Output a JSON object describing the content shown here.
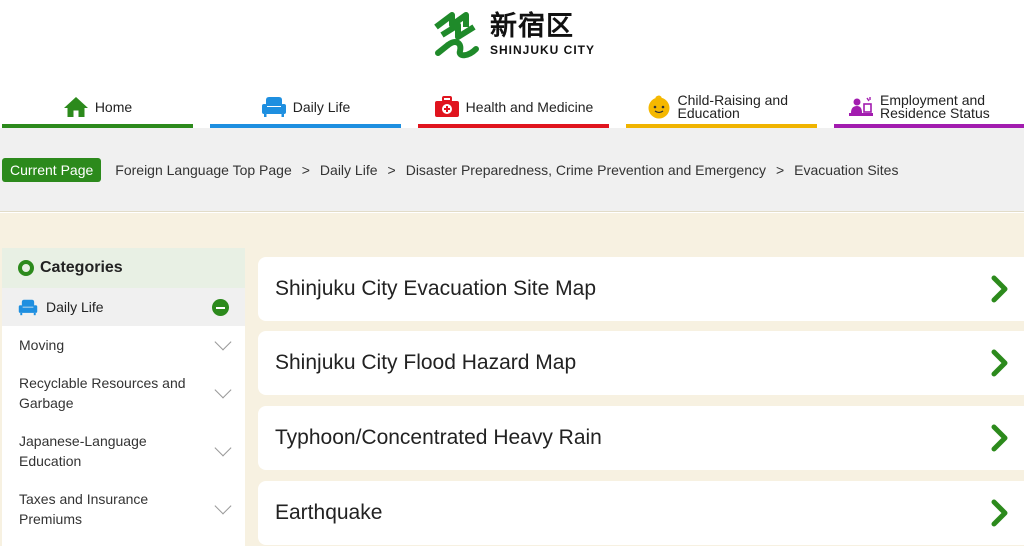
{
  "logo": {
    "kanji": "新宿区",
    "subtitle": "SHINJUKU CITY"
  },
  "nav": [
    {
      "label": "Home",
      "color": "#2c8a1c",
      "icon": "house-icon"
    },
    {
      "label": "Daily Life",
      "color": "#1e8fe0",
      "icon": "sofa-icon"
    },
    {
      "label": "Health and Medicine",
      "color": "#e0141e",
      "icon": "first-aid-kit-icon"
    },
    {
      "label": "Child-Raising and Education",
      "color": "#f0b400",
      "icon": "baby-face-icon"
    },
    {
      "label": "Employment and Residence Status",
      "color": "#a21caf",
      "icon": "worker-desk-icon"
    }
  ],
  "breadcrumb": {
    "badge": "Current Page",
    "items": [
      "Foreign Language Top Page",
      "Daily Life",
      "Disaster Preparedness, Crime Prevention and Emergency",
      "Evacuation Sites"
    ],
    "separator": ">"
  },
  "sidebar": {
    "title": "Categories",
    "current": "Daily Life",
    "items": [
      "Moving",
      "Recyclable Resources and Garbage",
      "Japanese-Language Education",
      "Taxes and Insurance Premiums"
    ]
  },
  "cards": [
    "Shinjuku City Evacuation Site Map",
    "Shinjuku City Flood Hazard Map",
    "Typhoon/Concentrated Heavy Rain",
    "Earthquake"
  ],
  "colors": {
    "accent": "#2c8a1c",
    "content_bg": "#f7f1e1",
    "crumb_bg": "#f0f0f0"
  }
}
